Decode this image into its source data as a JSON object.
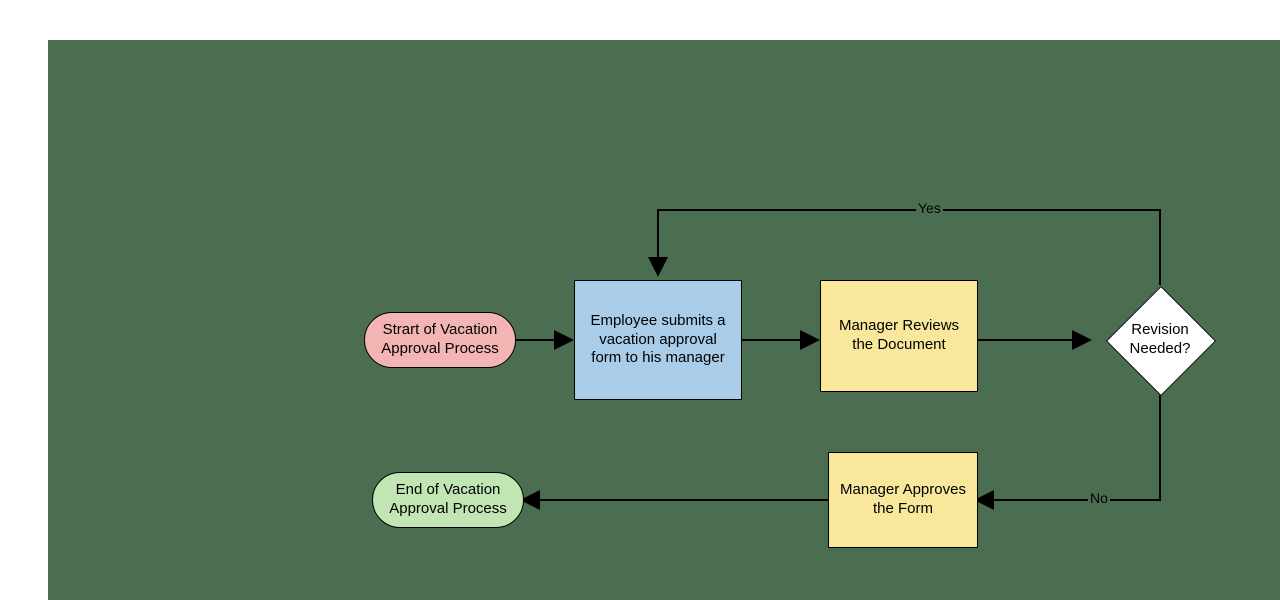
{
  "nodes": {
    "start": {
      "label": "Strart of Vacation Approval Process"
    },
    "submit": {
      "label": "Employee submits a vacation approval form to his manager"
    },
    "review": {
      "label": "Manager Reviews the Document"
    },
    "decision": {
      "label": "Revision Needed?"
    },
    "approve": {
      "label": "Manager Approves the Form"
    },
    "end": {
      "label": "End of Vacation Approval Process"
    }
  },
  "edges": {
    "yes": "Yes",
    "no": "No"
  }
}
